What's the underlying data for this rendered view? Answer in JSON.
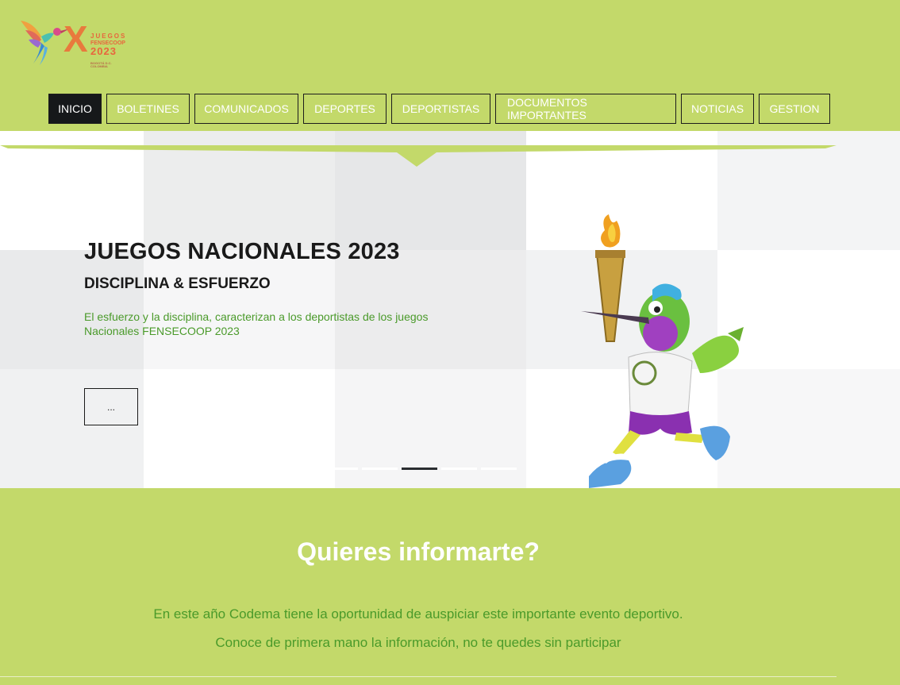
{
  "logo": {
    "letter": "X",
    "line1": "JUEGOS",
    "line2": "FENSECOOP",
    "year": "2023",
    "caption": "BOGOTÁ D.C. COLOMBIA"
  },
  "nav": {
    "items": [
      {
        "label": "INICIO"
      },
      {
        "label": "BOLETINES"
      },
      {
        "label": "COMUNICADOS"
      },
      {
        "label": "DEPORTES"
      },
      {
        "label": "DEPORTISTAS"
      },
      {
        "label": "DOCUMENTOS IMPORTANTES"
      },
      {
        "label": "NOTICIAS"
      },
      {
        "label": "GESTION"
      }
    ],
    "active_index": 0
  },
  "hero": {
    "title": "JUEGOS NACIONALES 2023",
    "subtitle": "DISCIPLINA & ESFUERZO",
    "description": "El esfuerzo y la disciplina, caracterizan a los deportistas de los juegos Nacionales FENSECOOP 2023",
    "button_label": "...",
    "slides_count": 5,
    "active_slide": 3
  },
  "info": {
    "title": "Quieres informarte?",
    "line1": "En este año Codema tiene la oportunidad de auspiciar este importante evento deportivo.",
    "line2": "Conoce de primera mano la información, no te quedes sin participar"
  },
  "colors": {
    "background": "#c3d96a",
    "accent_green": "#4a9a2a",
    "nav_active": "#16181a"
  }
}
